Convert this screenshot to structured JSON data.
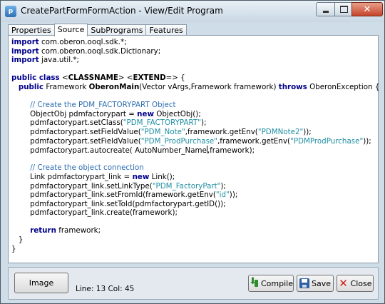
{
  "window": {
    "title": "CreatePartFormFormAction - View/Edit Program",
    "icon_letter": "p"
  },
  "tabs": [
    {
      "label": "Properties",
      "active": false
    },
    {
      "label": "Source",
      "active": true
    },
    {
      "label": "SubPrograms",
      "active": false
    },
    {
      "label": "Features",
      "active": false
    }
  ],
  "editor": {
    "lines": [
      [
        {
          "t": "import",
          "c": "keyword"
        },
        {
          "t": " com.oberon.ooql.sdk.*;"
        }
      ],
      [
        {
          "t": "import",
          "c": "keyword"
        },
        {
          "t": " com.oberon.ooql.sdk.Dictionary;"
        }
      ],
      [
        {
          "t": "import",
          "c": "keyword"
        },
        {
          "t": " java.util.*;"
        }
      ],
      [],
      [
        {
          "t": "public class",
          "c": "keyword"
        },
        {
          "t": " <"
        },
        {
          "t": "CLASSNAME",
          "c": "bold"
        },
        {
          "t": "> <"
        },
        {
          "t": "EXTEND",
          "c": "bold"
        },
        {
          "t": "=> {"
        }
      ],
      [
        {
          "t": "   "
        },
        {
          "t": "public",
          "c": "keyword"
        },
        {
          "t": " Framework "
        },
        {
          "t": "OberonMain",
          "c": "bold"
        },
        {
          "t": "(Vector vArgs,Framework framework) "
        },
        {
          "t": "throws",
          "c": "keyword"
        },
        {
          "t": " OberonException {"
        }
      ],
      [],
      [
        {
          "t": "        "
        },
        {
          "t": "// Create the PDM_FACTORYPART Object",
          "c": "comment"
        }
      ],
      [
        {
          "t": "        ObjectObj pdmfactorypart = "
        },
        {
          "t": "new",
          "c": "keyword"
        },
        {
          "t": " ObjectObj();"
        }
      ],
      [
        {
          "t": "        pdmfactorypart.setClass("
        },
        {
          "t": "\"PDM_FACTORYPART\"",
          "c": "string"
        },
        {
          "t": ");"
        }
      ],
      [
        {
          "t": "        pdmfactorypart.setFieldValue("
        },
        {
          "t": "\"PDM_Note\"",
          "c": "string"
        },
        {
          "t": ",framework.getEnv("
        },
        {
          "t": "\"PDMNote2\"",
          "c": "string"
        },
        {
          "t": "));"
        }
      ],
      [
        {
          "t": "        pdmfactorypart.setFieldValue("
        },
        {
          "t": "\"PDM_ProdPurchase\"",
          "c": "string"
        },
        {
          "t": ",framework.getEnv("
        },
        {
          "t": "\"PDMProdPurchase\"",
          "c": "string"
        },
        {
          "t": "));"
        }
      ],
      [
        {
          "t": "        pdmfactorypart.autocreate( AutoNumber_Name"
        },
        {
          "t": "",
          "c": "cursor"
        },
        {
          "t": ",framework);"
        }
      ],
      [],
      [
        {
          "t": "        "
        },
        {
          "t": "// Create the object connection",
          "c": "comment"
        }
      ],
      [
        {
          "t": "        Link pdmfactorypart_link = "
        },
        {
          "t": "new",
          "c": "keyword"
        },
        {
          "t": " Link();"
        }
      ],
      [
        {
          "t": "        pdmfactorypart_link.setLinkType("
        },
        {
          "t": "\"PDM_FactoryPart\"",
          "c": "string"
        },
        {
          "t": ");"
        }
      ],
      [
        {
          "t": "        pdmfactorypart_link.setFromId(framework.getEnv("
        },
        {
          "t": "\"id\"",
          "c": "string"
        },
        {
          "t": "));"
        }
      ],
      [
        {
          "t": "        pdmfactorypart_link.setToId(pdmfactorypart.getID());"
        }
      ],
      [
        {
          "t": "        pdmfactorypart_link.create(framework);"
        }
      ],
      [],
      [
        {
          "t": "        "
        },
        {
          "t": "return",
          "c": "keyword"
        },
        {
          "t": " framework;"
        }
      ],
      [
        {
          "t": "   }"
        }
      ],
      [
        {
          "t": "}"
        }
      ]
    ]
  },
  "bottom": {
    "image_label": "Image",
    "status": "Line: 13  Col: 45",
    "compile_label": "Compile",
    "save_label": "Save",
    "close_label": "Close"
  }
}
